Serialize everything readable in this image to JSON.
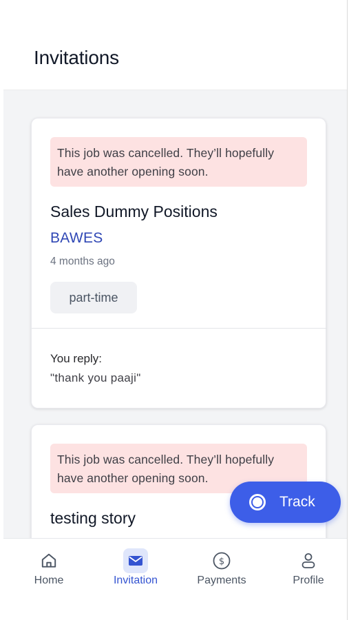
{
  "header": {
    "title": "Invitations"
  },
  "cards": [
    {
      "alert": "This job was cancelled. They’ll hopefully have another opening soon.",
      "title": "Sales Dummy Positions",
      "company": "BAWES",
      "time_ago": "4 months ago",
      "tag": "part-time",
      "reply_label": "You reply:",
      "reply_text": "\"thank you paaji\""
    },
    {
      "alert": "This job was cancelled. They’ll hopefully have another opening soon.",
      "title": "testing story"
    }
  ],
  "fab": {
    "label": "Track",
    "icon": "record-icon"
  },
  "nav": {
    "items": [
      {
        "label": "Home",
        "icon": "home-icon"
      },
      {
        "label": "Invitation",
        "icon": "mail-icon",
        "active": true
      },
      {
        "label": "Payments",
        "icon": "dollar-circle-icon"
      },
      {
        "label": "Profile",
        "icon": "user-icon"
      }
    ]
  },
  "colors": {
    "accent": "#3d5ee8",
    "company_link": "#2f47b5",
    "alert_bg": "#fde2e2",
    "nav_active": "#3454d1"
  }
}
